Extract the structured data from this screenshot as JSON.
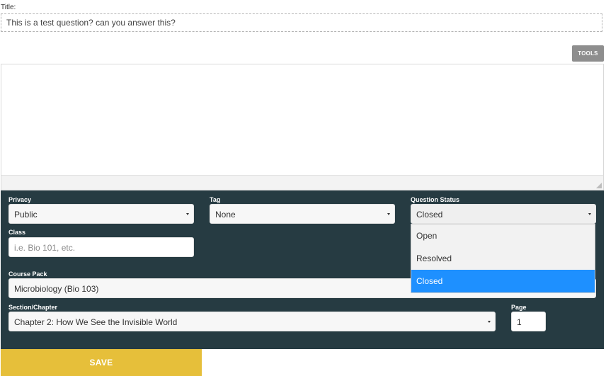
{
  "title": {
    "label": "Title:",
    "value": "This is a test question? can you answer this?"
  },
  "toolbar": {
    "tools_label": "TOOLS"
  },
  "form": {
    "privacy": {
      "label": "Privacy",
      "value": "Public"
    },
    "tag": {
      "label": "Tag",
      "value": "None"
    },
    "question_status": {
      "label": "Question Status",
      "value": "Closed",
      "options": [
        "Open",
        "Resolved",
        "Closed"
      ],
      "selected_index": 2
    },
    "class": {
      "label": "Class",
      "placeholder": "i.e. Bio 101, etc."
    },
    "course_pack": {
      "label": "Course Pack",
      "value": "Microbiology (Bio 103)"
    },
    "section": {
      "label": "Section/Chapter",
      "value": "Chapter 2: How We See the Invisible World"
    },
    "page": {
      "label": "Page",
      "value": "1"
    }
  },
  "actions": {
    "save_label": "SAVE"
  },
  "colors": {
    "panel": "#263b42",
    "save": "#e6bf3a",
    "selected": "#1e90ff",
    "tools": "#8e8e8e"
  }
}
